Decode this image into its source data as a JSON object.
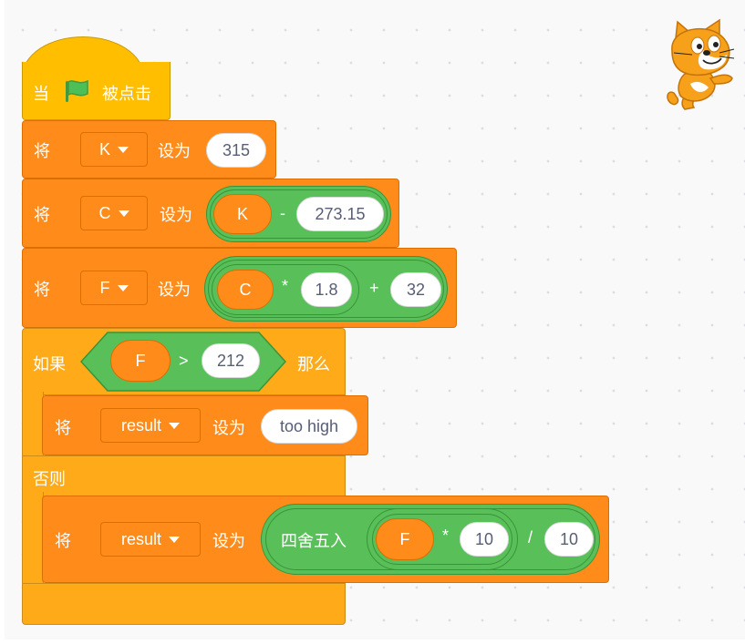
{
  "hat": {
    "when": "当",
    "flag_icon": "green-flag-icon",
    "clicked": "被点击"
  },
  "set_k": {
    "set": "将",
    "var": "K",
    "to": "设为",
    "value": "315"
  },
  "set_c": {
    "set": "将",
    "var": "C",
    "to": "设为",
    "left": "K",
    "op": "-",
    "right": "273.15"
  },
  "set_f": {
    "set": "将",
    "var": "F",
    "to": "设为",
    "a": "C",
    "op1": "*",
    "b": "1.8",
    "op2": "+",
    "c": "32"
  },
  "if_block": {
    "if": "如果",
    "left": "F",
    "op": ">",
    "right": "212",
    "then": "那么",
    "else": "否则",
    "then_set": {
      "set": "将",
      "var": "result",
      "to": "设为",
      "value": "too high"
    },
    "else_set": {
      "set": "将",
      "var": "result",
      "to": "设为",
      "round": "四舍五入",
      "a": "F",
      "op1": "*",
      "b": "10",
      "op2": "/",
      "c": "10"
    }
  },
  "sprite_icon": "scratch-cat-icon",
  "colors": {
    "events": "#ffbf00",
    "variables": "#ff8c1a",
    "control": "#ffab19",
    "operators": "#59c059",
    "background": "#f9f9f9"
  }
}
